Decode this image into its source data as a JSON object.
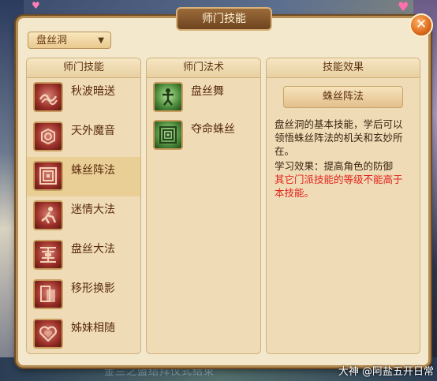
{
  "window": {
    "title": "师门技能",
    "close_glyph": "✕"
  },
  "school_select": {
    "value": "盘丝洞",
    "arrow": "▼"
  },
  "columns": {
    "skills_header": "师门技能",
    "arts_header": "师门法术",
    "effect_header": "技能效果"
  },
  "skills": [
    {
      "label": "秋波暗送",
      "icon": "wave-icon"
    },
    {
      "label": "天外魔音",
      "icon": "bell-icon"
    },
    {
      "label": "蛛丝阵法",
      "icon": "spiral-maze-icon",
      "selected": true
    },
    {
      "label": "迷情大法",
      "icon": "figure-icon"
    },
    {
      "label": "盘丝大法",
      "icon": "web-icon"
    },
    {
      "label": "移形换影",
      "icon": "shadow-icon"
    },
    {
      "label": "姊妹相随",
      "icon": "heart-icon"
    }
  ],
  "arts": [
    {
      "label": "盘丝舞",
      "icon": "dancer-icon"
    },
    {
      "label": "夺命蛛丝",
      "icon": "maze-icon"
    }
  ],
  "effect": {
    "title": "蛛丝阵法",
    "description": "盘丝洞的基本技能，学后可以领悟蛛丝阵法的机关和玄妙所在。",
    "effect_line": "学习效果：提高角色的防御",
    "warning": "其它门派技能的等级不能高于本技能。"
  },
  "watermark": "大神 @阿盐五开日常",
  "background_text": "金兰之盟结拜仪式结束"
}
